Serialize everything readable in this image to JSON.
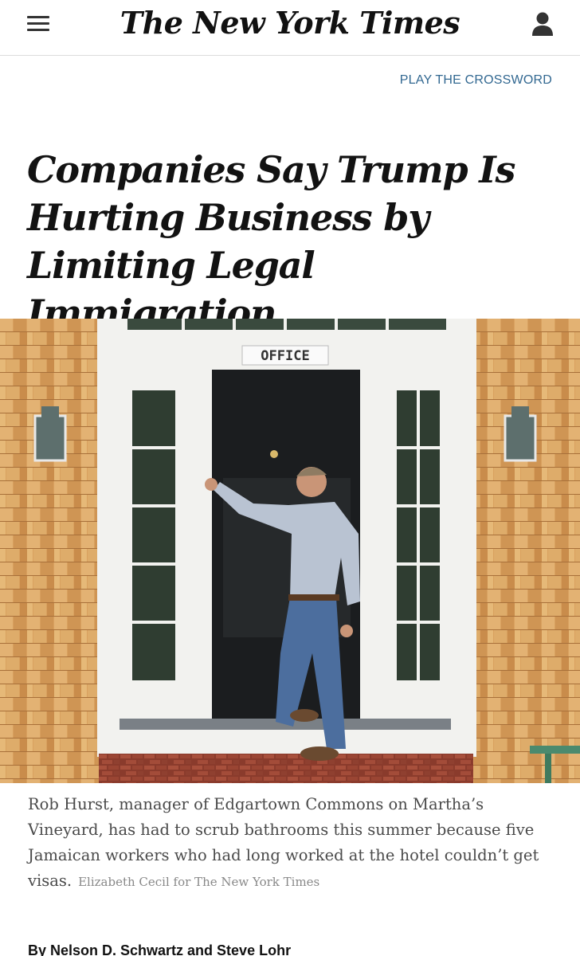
{
  "header": {
    "logo": "The New York Times",
    "menu_icon": "hamburger-menu-icon",
    "account_icon": "user-account-icon"
  },
  "crossword_link": "PLAY THE CROSSWORD",
  "article": {
    "headline": "Companies Say Trump Is Hurting Business by Limiting Legal Immigration",
    "photo_sign": "OFFICE",
    "caption": "Rob Hurst, manager of Edgartown Commons on Martha’s Vineyard, has had to scrub bathrooms this summer because five Jamaican workers who had long worked at the hotel couldn’t get visas.",
    "credit": "Elizabeth Cecil for The New York Times",
    "byline": "By Nelson D. Schwartz and Steve Lohr"
  },
  "colors": {
    "link": "#326891",
    "text": "#121212",
    "caption": "#4a4a4a"
  }
}
